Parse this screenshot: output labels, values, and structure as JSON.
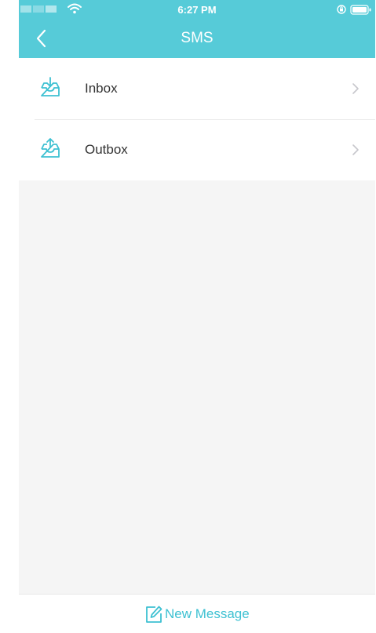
{
  "status_bar": {
    "time": "6:27 PM"
  },
  "nav": {
    "title": "SMS",
    "back_icon": "chevron-left-icon"
  },
  "list": {
    "items": [
      {
        "label": "Inbox",
        "icon": "inbox-download-icon"
      },
      {
        "label": "Outbox",
        "icon": "outbox-upload-icon"
      }
    ]
  },
  "bottom": {
    "new_message_label": "New Message",
    "icon": "compose-icon"
  },
  "colors": {
    "accent": "#56cbd8",
    "accent_text": "#3ec1d2",
    "background": "#f5f5f5",
    "text": "#333333"
  }
}
